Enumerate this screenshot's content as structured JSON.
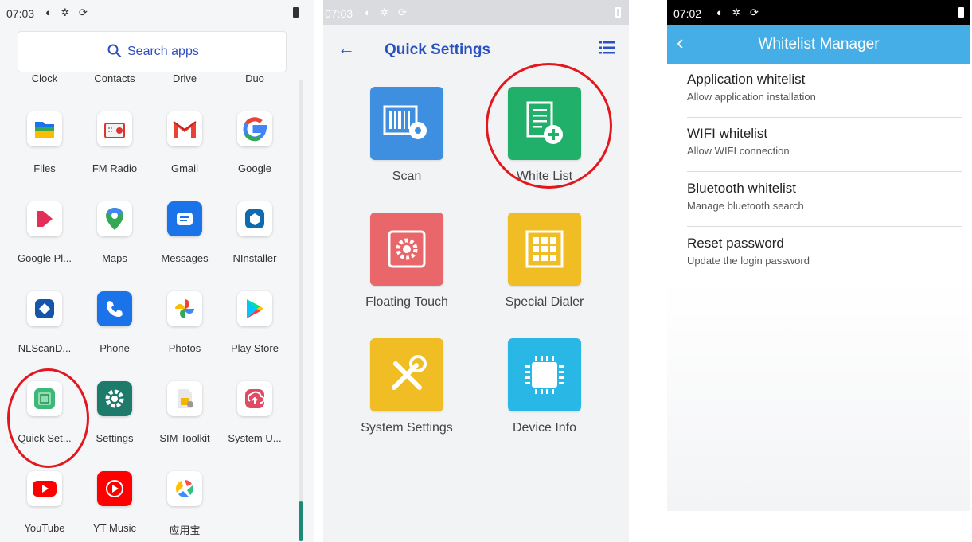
{
  "panel1": {
    "status": {
      "time": "07:03",
      "icons": "◐ ✲ ⟳"
    },
    "search": {
      "label": "Search apps"
    },
    "top_row": [
      "Clock",
      "Contacts",
      "Drive",
      "Duo"
    ],
    "apps": [
      {
        "label": "Files",
        "icon": "files-icon",
        "color": "#ffffff"
      },
      {
        "label": "FM Radio",
        "icon": "radio-icon",
        "color": "#ffffff"
      },
      {
        "label": "Gmail",
        "icon": "gmail-icon",
        "color": "#ffffff"
      },
      {
        "label": "Google",
        "icon": "google-icon",
        "color": "#ffffff"
      },
      {
        "label": "Google Pl...",
        "icon": "play-movies-icon",
        "color": "#ffffff"
      },
      {
        "label": "Maps",
        "icon": "maps-icon",
        "color": "#ffffff"
      },
      {
        "label": "Messages",
        "icon": "messages-icon",
        "color": "#1a73e8"
      },
      {
        "label": "NInstaller",
        "icon": "ninstaller-icon",
        "color": "#ffffff"
      },
      {
        "label": "NLScanD...",
        "icon": "nlscan-icon",
        "color": "#ffffff"
      },
      {
        "label": "Phone",
        "icon": "phone-icon",
        "color": "#1a73e8"
      },
      {
        "label": "Photos",
        "icon": "photos-icon",
        "color": "#ffffff"
      },
      {
        "label": "Play Store",
        "icon": "play-store-icon",
        "color": "#ffffff"
      },
      {
        "label": "Quick Set...",
        "icon": "quick-settings-icon",
        "color": "#ffffff"
      },
      {
        "label": "Settings",
        "icon": "settings-icon",
        "color": "#1e7b6b"
      },
      {
        "label": "SIM Toolkit",
        "icon": "sim-toolkit-icon",
        "color": "#ffffff"
      },
      {
        "label": "System U...",
        "icon": "system-update-icon",
        "color": "#ffffff"
      },
      {
        "label": "YouTube",
        "icon": "youtube-icon",
        "color": "#ffffff"
      },
      {
        "label": "YT Music",
        "icon": "yt-music-icon",
        "color": "#ff0000"
      },
      {
        "label": "应用宝",
        "icon": "app-store-icon",
        "color": "#ffffff"
      }
    ]
  },
  "panel2": {
    "status": {
      "time": "07:03",
      "icons": "◐ ✲ ⟳"
    },
    "title": "Quick Settings",
    "tiles": [
      {
        "label": "Scan",
        "icon": "scan-icon",
        "color": "#3f8fe0"
      },
      {
        "label": "White List",
        "icon": "white-list-icon",
        "color": "#21b06a"
      },
      {
        "label": "Floating Touch",
        "icon": "floating-touch-icon",
        "color": "#e9666a"
      },
      {
        "label": "Special Dialer",
        "icon": "special-dialer-icon",
        "color": "#f0bd25"
      },
      {
        "label": "System Settings",
        "icon": "system-settings-icon",
        "color": "#f0bd25"
      },
      {
        "label": "Device Info",
        "icon": "device-info-icon",
        "color": "#29b8e6"
      }
    ]
  },
  "panel3": {
    "status": {
      "time": "07:02",
      "icons": "◐ ✲ ⟳"
    },
    "title": "Whitelist Manager",
    "items": [
      {
        "title": "Application whitelist",
        "subtitle": "Allow application installation"
      },
      {
        "title": "WIFI whitelist",
        "subtitle": "Allow WIFI connection"
      },
      {
        "title": "Bluetooth whitelist",
        "subtitle": "Manage bluetooth search"
      },
      {
        "title": "Reset password",
        "subtitle": "Update the login password"
      }
    ]
  },
  "colors": {
    "accent_blue": "#2a52be",
    "toolbar_blue": "#46aee6",
    "highlight_red": "#e3171e"
  }
}
